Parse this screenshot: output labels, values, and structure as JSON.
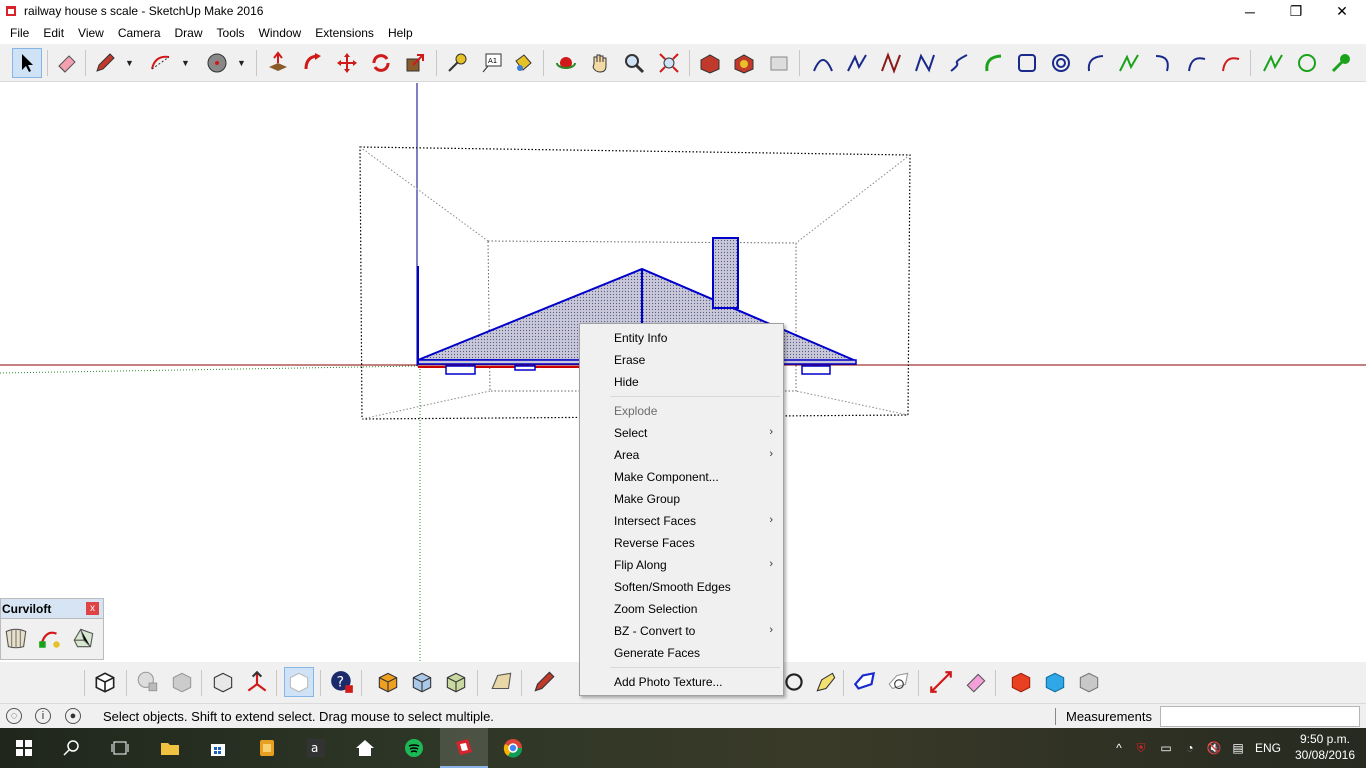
{
  "window": {
    "title": "railway house s scale - SketchUp Make 2016",
    "minimize": "─",
    "restore": "❐",
    "close": "✕"
  },
  "menubar": [
    "File",
    "Edit",
    "View",
    "Camera",
    "Draw",
    "Tools",
    "Window",
    "Extensions",
    "Help"
  ],
  "curviloft": {
    "title": "Curviloft",
    "close": "x"
  },
  "context_menu": {
    "items": [
      {
        "label": "Entity Info",
        "submenu": false,
        "enabled": true
      },
      {
        "label": "Erase",
        "submenu": false,
        "enabled": true
      },
      {
        "label": "Hide",
        "submenu": false,
        "enabled": true
      },
      {
        "label": "Explode",
        "submenu": false,
        "enabled": false
      },
      {
        "label": "Select",
        "submenu": true,
        "enabled": true
      },
      {
        "label": "Area",
        "submenu": true,
        "enabled": true
      },
      {
        "label": "Make Component...",
        "submenu": false,
        "enabled": true
      },
      {
        "label": "Make Group",
        "submenu": false,
        "enabled": true
      },
      {
        "label": "Intersect Faces",
        "submenu": true,
        "enabled": true
      },
      {
        "label": "Reverse Faces",
        "submenu": false,
        "enabled": true
      },
      {
        "label": "Flip Along",
        "submenu": true,
        "enabled": true
      },
      {
        "label": "Soften/Smooth Edges",
        "submenu": false,
        "enabled": true
      },
      {
        "label": "Zoom Selection",
        "submenu": false,
        "enabled": true
      },
      {
        "label": "BZ - Convert to",
        "submenu": true,
        "enabled": true
      },
      {
        "label": "Generate Faces",
        "submenu": false,
        "enabled": true
      },
      {
        "label": "Add Photo Texture...",
        "submenu": false,
        "enabled": true
      }
    ],
    "submenu_arrow": "›"
  },
  "statusbar": {
    "hint": "Select objects. Shift to extend select. Drag mouse to select multiple.",
    "measurements_label": "Measurements",
    "measurements_value": "",
    "info_icon": "i"
  },
  "taskbar": {
    "language": "ENG",
    "time": "9:50 p.m.",
    "date": "30/08/2016"
  },
  "colors": {
    "selection_blue": "#0000cc",
    "axis_red": "#b30000",
    "axis_green": "#00a000",
    "face_fill": "#c8c8d8"
  }
}
